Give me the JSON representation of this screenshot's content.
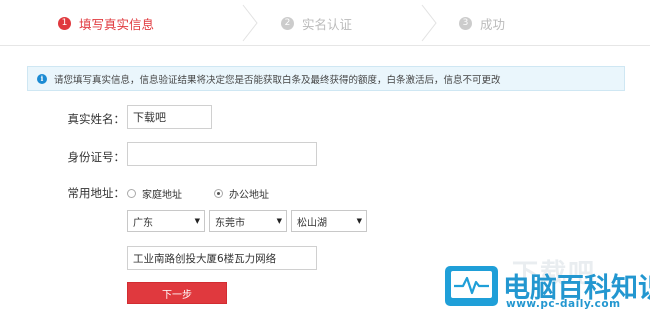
{
  "colors": {
    "active": "#e0393e",
    "inactive": "#cccccc",
    "info": "#1b8bd3",
    "button": "#e0393e",
    "watermark": "#2397d0"
  },
  "steps": [
    {
      "num": "1",
      "label": "填写真实信息",
      "state": "active"
    },
    {
      "num": "2",
      "label": "实名认证",
      "state": "inactive"
    },
    {
      "num": "3",
      "label": "成功",
      "state": "inactive"
    }
  ],
  "notice": {
    "icon": "info-icon",
    "text": "请您填写真实信息，信息验证结果将决定您是否能获取白条及最终获得的额度，白条激活后，信息不可更改"
  },
  "form": {
    "name_label": "真实姓名：",
    "name_value": "下载吧",
    "id_label": "身份证号：",
    "id_value": "",
    "address_label": "常用地址：",
    "radio_home": "家庭地址",
    "radio_office": "办公地址",
    "selected_radio": "办公地址",
    "province": "广东",
    "city": "东莞市",
    "district": "松山湖",
    "detail_address": "工业南路创投大厦6楼瓦力网络",
    "next_button": "下一步"
  },
  "watermark": {
    "ghost": "下载吧",
    "title": "电脑百科知识",
    "url": "www.pc-daily.com"
  }
}
